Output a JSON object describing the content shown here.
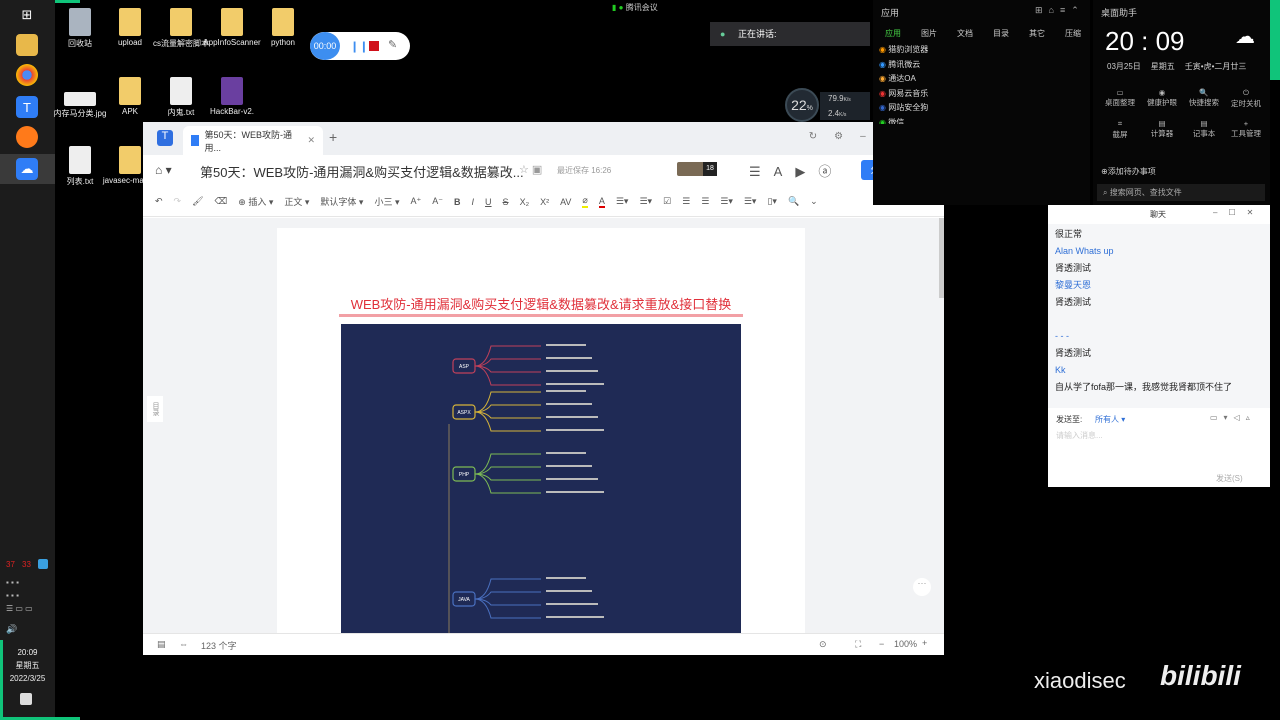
{
  "desktop": {
    "icons": [
      {
        "label": "回收站",
        "type": "recycle"
      },
      {
        "label": "upload",
        "type": "folder"
      },
      {
        "label": "cs流量解密脚本",
        "type": "folder"
      },
      {
        "label": "AppInfoScanner",
        "type": "folder"
      },
      {
        "label": "python",
        "type": "folder"
      },
      {
        "label": "内存马分类.jpg",
        "type": "image"
      },
      {
        "label": "APK",
        "type": "folder"
      },
      {
        "label": "内鬼.txt",
        "type": "file"
      },
      {
        "label": "HackBar-v2.",
        "type": "folder"
      },
      {
        "label": "列表.txt",
        "type": "file"
      },
      {
        "label": "javasec-master",
        "type": "folder"
      }
    ]
  },
  "taskbar": {
    "tray_numbers": [
      "37",
      "33"
    ],
    "time": "20:09",
    "weekday": "星期五",
    "date": "2022/3/25"
  },
  "recorder": {
    "timer": "00:00"
  },
  "meeting": {
    "app": "腾讯会议",
    "speaking": "正在讲话:"
  },
  "netmon": {
    "cpu": "22",
    "unit": "%",
    "up": "79.9",
    "down": "2.4",
    "speed_unit": "K/s"
  },
  "document": {
    "tab_title": "第50天：WEB攻防-通用...",
    "title": "第50天：WEB攻防-通用漏洞&购买支付逻辑&数据篡改...",
    "saved": "最近保存 16:26",
    "collab_count": "18",
    "share": "分享",
    "toolbar": {
      "insert": "插入",
      "style": "正文",
      "font": "默认字体",
      "size": "小三"
    },
    "heading": "WEB攻防-通用漏洞&购买支付逻辑&数据篡改&请求重放&接口替换",
    "mindmap_nodes": [
      "ASP",
      "ASPX",
      "PHP",
      "JAVA"
    ],
    "toc_label": "目录",
    "word_count": "123 个字",
    "zoom": "100%"
  },
  "apps_panel": {
    "title": "应用",
    "tabs": [
      "应用",
      "图片",
      "文档",
      "目录",
      "其它",
      "压缩"
    ],
    "items": [
      "猎豹浏览器",
      "腾讯微云",
      "通达OA",
      "网易云音乐",
      "网站安全狗",
      "微信"
    ]
  },
  "assistant": {
    "title": "桌面助手",
    "time": "20 : 09",
    "date": "03月25日",
    "weekday": "星期五",
    "lunar": "壬寅•虎•二月廿三",
    "tools": [
      "桌面整理",
      "健康护眼",
      "快捷搜索",
      "定时关机",
      "截屏",
      "计算器",
      "记事本",
      "工具管理"
    ],
    "todo": "添加待办事项",
    "search": "搜索网页、查找文件"
  },
  "chat": {
    "title": "聊天",
    "messages": [
      {
        "text": "很正常",
        "name": false
      },
      {
        "text": "Alan Whats up",
        "name": true
      },
      {
        "text": "肾透测试",
        "name": false
      },
      {
        "text": "黎曼天恩",
        "name": true
      },
      {
        "text": "肾透测试",
        "name": false
      },
      {
        "text": "",
        "name": false
      },
      {
        "text": "- - -",
        "name": true
      },
      {
        "text": "肾透测试",
        "name": false
      },
      {
        "text": "Kk",
        "name": true
      },
      {
        "text": "自从学了fofa那一课，我感觉我肾都顶不住了",
        "name": false
      }
    ],
    "send_to_label": "发送至:",
    "send_to": "所有人",
    "placeholder": "请输入消息...",
    "send": "发送(S)"
  },
  "watermark": {
    "channel": "xiaodisec",
    "site": "bilibili"
  },
  "colors": {
    "accent": "#10c47a",
    "share": "#2f7df6",
    "heading": "#e0303a",
    "mindmap_bg": "#1f2a55"
  }
}
